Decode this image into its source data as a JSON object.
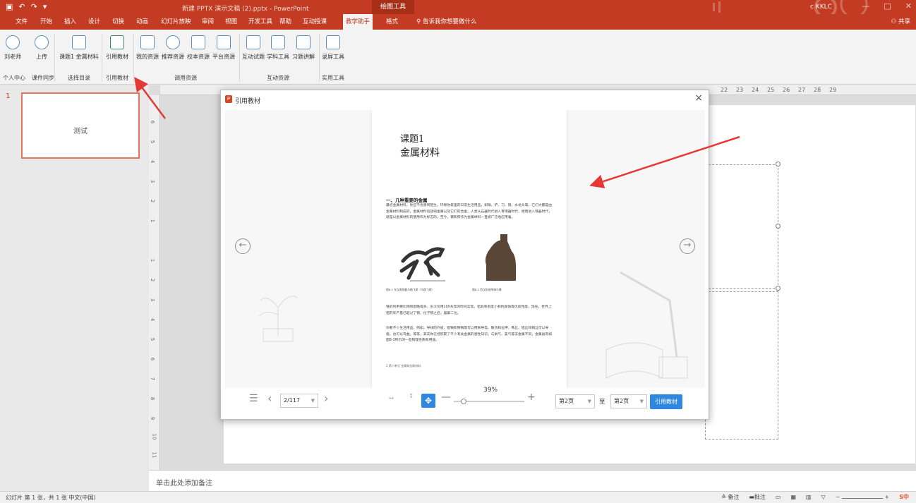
{
  "titlebar": {
    "title": "新建 PPTX 演示文稿 (2).pptx  -  PowerPoint",
    "context_tool": "绘图工具",
    "user": "c KKLC",
    "quick_access": [
      "save-icon",
      "undo-icon",
      "redo-icon",
      "customize-icon"
    ]
  },
  "tabs": [
    "文件",
    "开始",
    "插入",
    "设计",
    "切换",
    "动画",
    "幻灯片放映",
    "审阅",
    "视图",
    "开发工具",
    "帮助",
    "互动授课",
    "教学助手",
    "格式"
  ],
  "active_tab": "教学助手",
  "tell_me": "告诉我你想要做什么",
  "share": "共享",
  "ribbon": {
    "buttons": [
      "刘老师",
      "上传",
      "课题1 金属材料",
      "引用教材",
      "我的资源",
      "推荐资源",
      "校本资源",
      "平台资源",
      "互动试题",
      "学科工具",
      "习题讲解",
      "录屏工具"
    ],
    "groups": [
      "个人中心",
      "课件同步",
      "选择目录",
      "引用教材",
      "调用资源",
      "互动资源",
      "实用工具"
    ]
  },
  "thumbs": {
    "number": "1",
    "slide_text": "测试"
  },
  "ruler": {
    "h_labels": [
      "22",
      "23",
      "24",
      "25",
      "26",
      "27",
      "28",
      "29"
    ],
    "v_labels": [
      "6",
      "5",
      "4",
      "3",
      "2",
      "1",
      "1",
      "2",
      "3",
      "4",
      "5",
      "6",
      "7",
      "8",
      "9",
      "10",
      "11"
    ]
  },
  "notes_placeholder": "单击此处添加备注",
  "status": {
    "left": "幻灯片 第 1 张，共 1 张   中文(中国)",
    "notes": "备注",
    "comments": "批注"
  },
  "dialog": {
    "title": "引用教材",
    "close": "×",
    "page": {
      "title1": "课题1",
      "title2": "金属材料",
      "heading": "一、几种重要的金属",
      "para1": "最初金属材料，你应不会感到陌生。环顾你家里的日常生活用品，如锅、铲、刀、锁、水龙头等，它们大都是由金属材料制成的。金属材料包括纯金属以及它们的合金。人类从石器时代进入青铜器时代，继而进入铁器时代，就是以金属材料的使用作为标志的。至今，钢和铁作为金属材料一直被广泛地应用着。",
      "cap1": "图8-1 东汉青铜器马踏飞燕（马踏飞燕）",
      "cap2": "图8-2 西汉彩绘陶骑马俑",
      "para2": "铁的利用要比铜和铝晚得多，东汉仅用100多年的时间实现。铝具有密度小和抗腐蚀等优良性能，现在，世界上铝的年产量已超过了铜，位于铁之后，居第二位。",
      "para3": "你看不少生活用品，例如，导线的外皮、铝锅和铁锅等可以用来导电、散热和拉伸，铁丝、铝丝和铜丝可以导电，也可以弯曲。等等，其实你已经积累了不少有关金属的感性知识，与氧气、氯气等非金属不同，金属具有如图8-3所示的一些物理性质和用途。",
      "footer": "2   第八单元  金属和金属材料"
    },
    "page_select": "2/117",
    "zoom": "39%",
    "range_from": "第2页",
    "range_to_label": "至",
    "range_to": "第2页",
    "cite_button": "引用教材"
  },
  "colors": {
    "brand": "#c23b22",
    "accent": "#2f87e0",
    "arrow": "#e53935"
  }
}
